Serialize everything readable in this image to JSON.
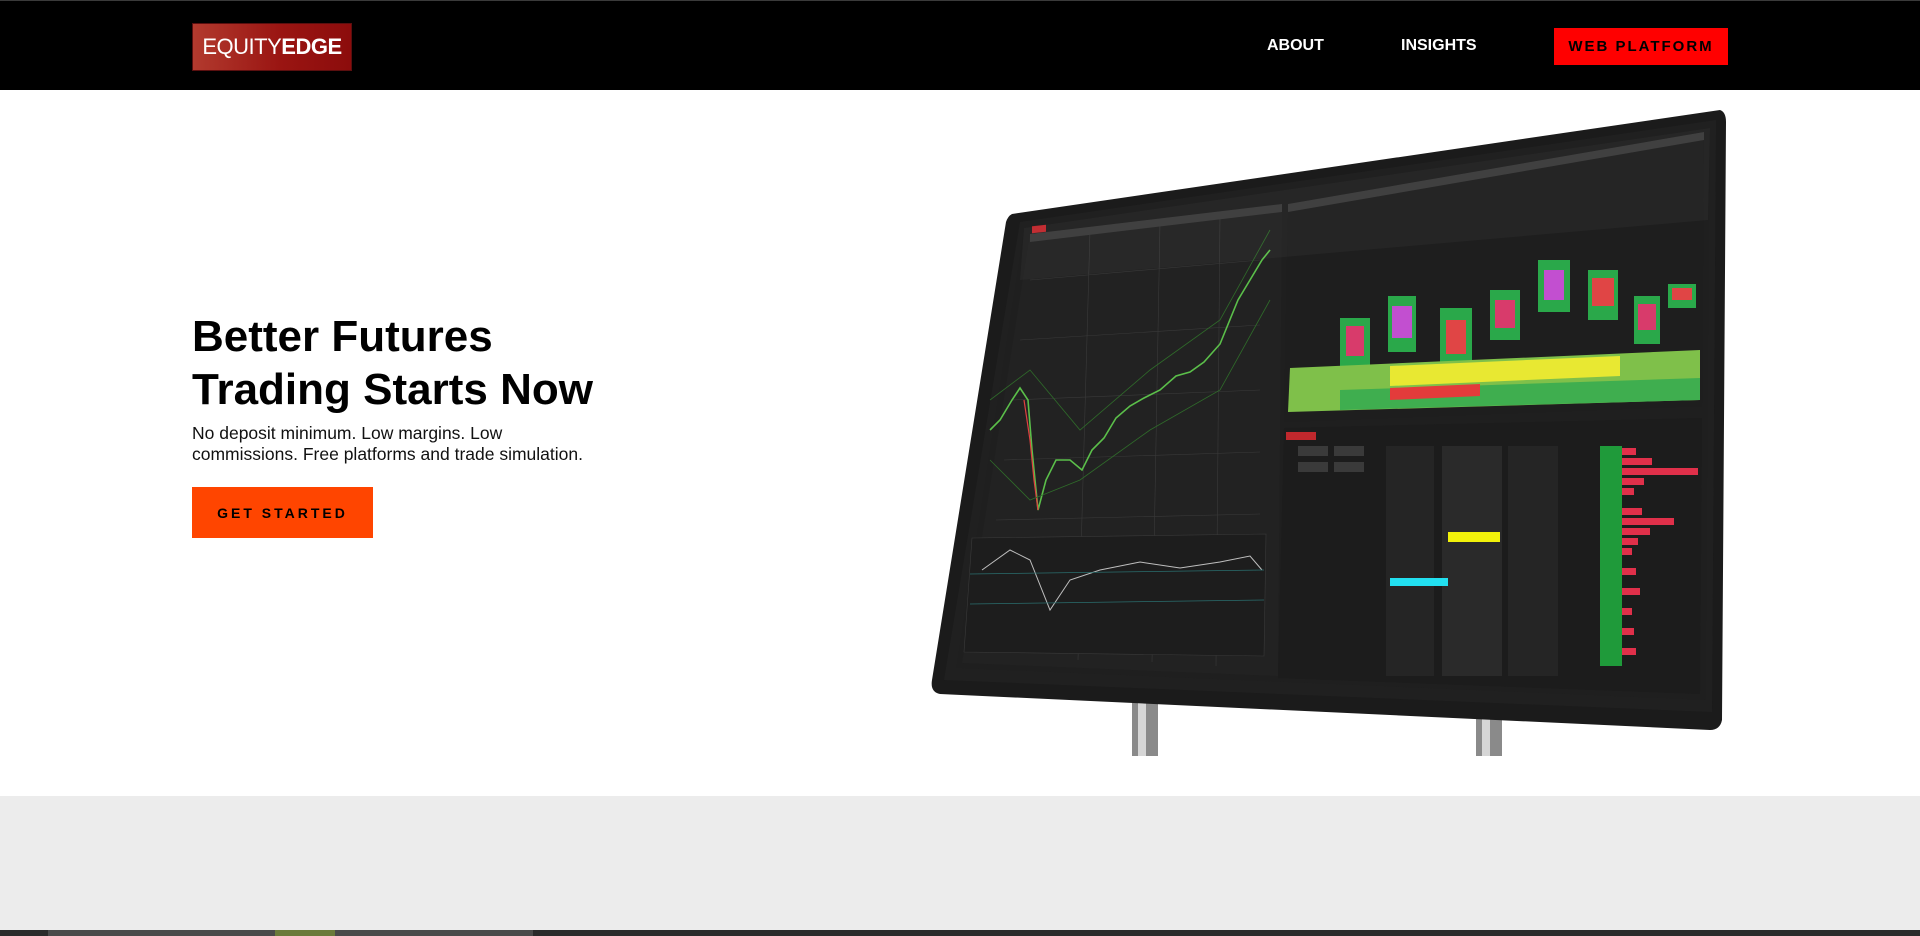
{
  "header": {
    "logo_part1": "EQUITY",
    "logo_part2": "EDGE",
    "nav": [
      {
        "label": "ABOUT"
      },
      {
        "label": "INSIGHTS"
      }
    ],
    "cta_label": "WEB PLATFORM"
  },
  "hero": {
    "title_line1": "Better Futures",
    "title_line2": "Trading Starts Now",
    "subtitle": "No deposit minimum. Low margins. Low commissions. Free platforms and trade simulation.",
    "cta_label": "GET STARTED"
  },
  "colors": {
    "header_bg": "#000000",
    "web_platform_button": "#ff0000",
    "get_started_button": "#ff4500",
    "logo_gradient": "#9a1512",
    "lower_band": "#ececec"
  },
  "icons": {
    "monitor": "trading-platform-monitor-image"
  }
}
